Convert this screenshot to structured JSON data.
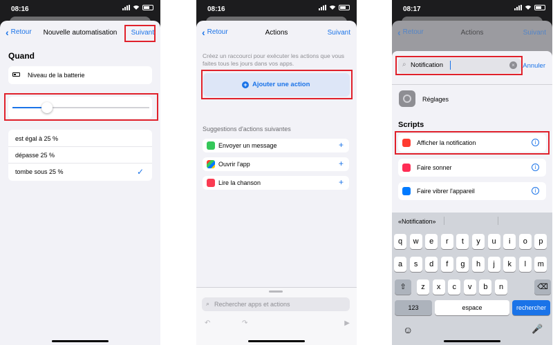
{
  "screen1": {
    "time": "08:16",
    "back": "Retour",
    "title": "Nouvelle automatisation",
    "next": "Suivant",
    "section": "Quand",
    "battery_label": "Niveau de la batterie",
    "slider_level": 0.25,
    "options": [
      "est égal à 25 %",
      "dépasse 25 %",
      "tombe sous 25 %"
    ],
    "checkmark": "✓"
  },
  "screen2": {
    "time": "08:16",
    "back": "Retour",
    "title": "Actions",
    "next": "Suivant",
    "intro": "Créez un raccourci pour exécuter les actions que vous faites tous les jours dans vos apps.",
    "add_action": "Ajouter une action",
    "suggestions_title": "Suggestions d'actions suivantes",
    "suggestions": [
      "Envoyer un message",
      "Ouvrir l'app",
      "Lire la chanson"
    ],
    "search_placeholder": "Rechercher apps et actions"
  },
  "screen3": {
    "time": "08:17",
    "back": "Retour",
    "title": "Actions",
    "next": "Suivant",
    "search_value": "Notification",
    "cancel": "Annuler",
    "settings_label": "Réglages",
    "scripts_title": "Scripts",
    "scripts": [
      "Afficher la notification",
      "Faire sonner",
      "Faire vibrer l'appareil"
    ],
    "autocomplete": "«Notification»",
    "row1": [
      "q",
      "w",
      "e",
      "r",
      "t",
      "y",
      "u",
      "i",
      "o",
      "p"
    ],
    "row2": [
      "a",
      "s",
      "d",
      "f",
      "g",
      "h",
      "j",
      "k",
      "l",
      "m"
    ],
    "row3": [
      "z",
      "x",
      "c",
      "v",
      "b",
      "n"
    ],
    "key_123": "123",
    "key_space": "espace",
    "key_search": "rechercher"
  },
  "colors": {
    "accent": "#1a73e8",
    "highlight": "#e0202a"
  }
}
